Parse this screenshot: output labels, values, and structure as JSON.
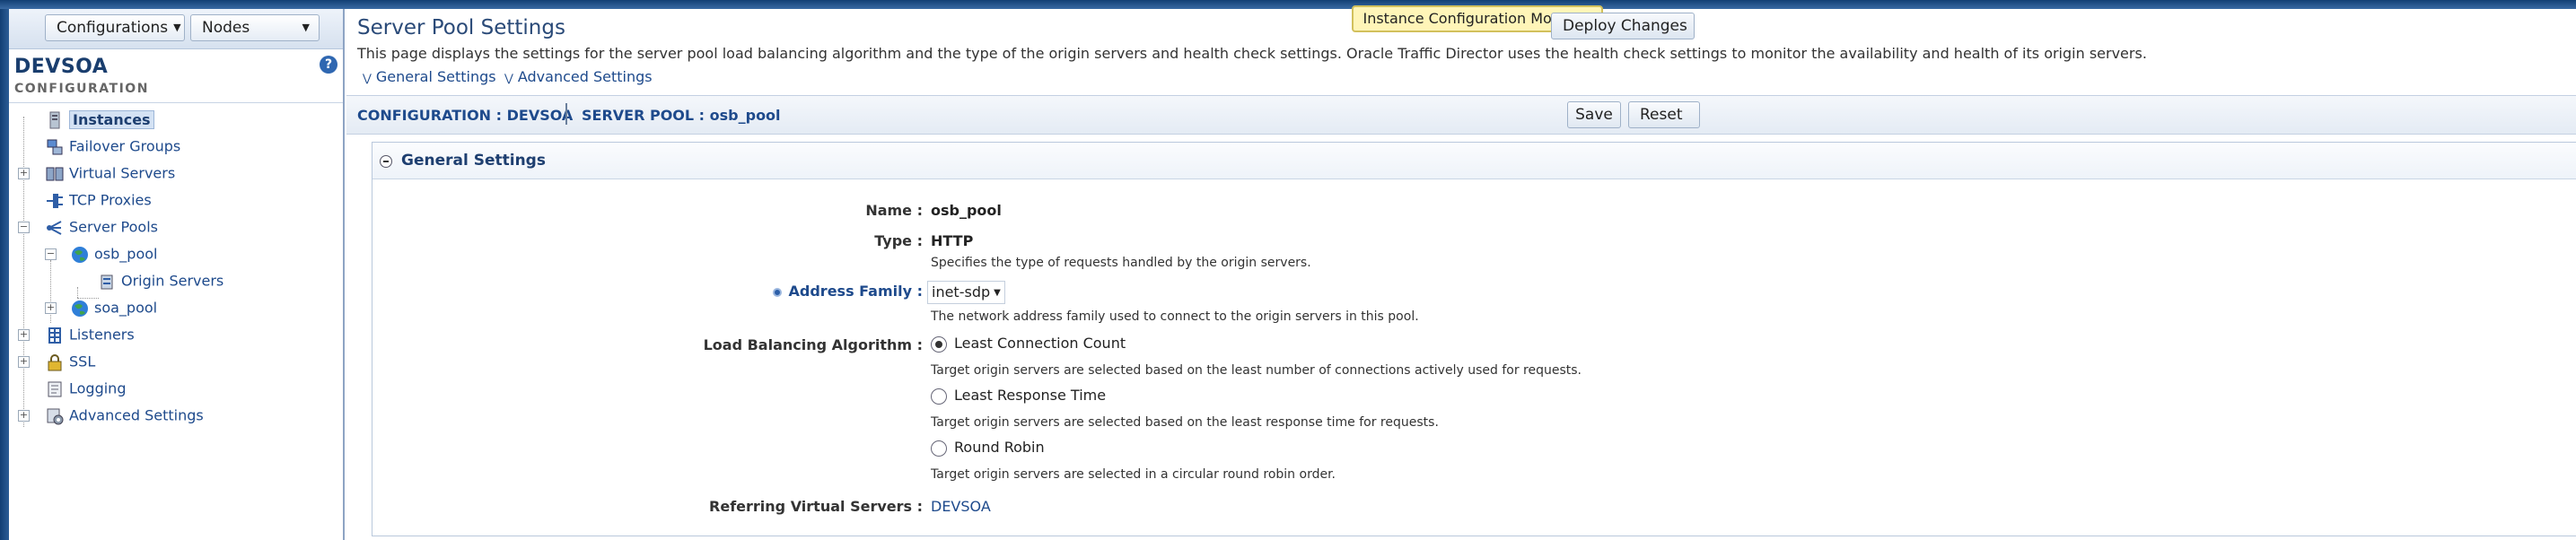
{
  "sidebar": {
    "config_dropdown": "Configurations",
    "nodes_dropdown": "Nodes",
    "title": "DEVSOA",
    "subtitle": "CONFIGURATION",
    "help_icon": "question-icon",
    "tree": [
      {
        "label": "Instances",
        "icon": "instances-icon",
        "selected": true
      },
      {
        "label": "Failover Groups",
        "icon": "failover-icon"
      },
      {
        "label": "Virtual Servers",
        "icon": "virtual-servers-icon"
      },
      {
        "label": "TCP Proxies",
        "icon": "tcp-proxy-icon"
      },
      {
        "label": "Server Pools",
        "icon": "server-pools-icon"
      },
      {
        "label": "osb_pool",
        "icon": "globe-icon"
      },
      {
        "label": "Origin Servers",
        "icon": "origin-servers-icon"
      },
      {
        "label": "soa_pool",
        "icon": "globe-icon"
      },
      {
        "label": "Listeners",
        "icon": "listeners-icon"
      },
      {
        "label": "SSL",
        "icon": "lock-icon"
      },
      {
        "label": "Logging",
        "icon": "logging-icon"
      },
      {
        "label": "Advanced Settings",
        "icon": "advanced-settings-icon"
      }
    ]
  },
  "header": {
    "title": "Server Pool Settings",
    "description": "This page displays the settings for the server pool load balancing algorithm and the type of the origin servers and health check settings. Oracle Traffic Director uses the health check settings to monitor the availability and health of its origin servers.",
    "anchor_general": "General Settings",
    "anchor_advanced": "Advanced Settings",
    "banner": "Instance Configuration Modified",
    "deploy_button": "Deploy Changes"
  },
  "breadcrumb": {
    "config": "CONFIGURATION : DEVSOA",
    "pool": "SERVER POOL : osb_pool",
    "save": "Save",
    "reset": "Reset"
  },
  "general": {
    "section_title": "General Settings",
    "name_label": "Name :",
    "name_value": "osb_pool",
    "type_label": "Type :",
    "type_value": "HTTP",
    "type_hint": "Specifies the type of requests handled by the origin servers.",
    "family_label": "Address Family :",
    "family_value": "inet-sdp",
    "family_hint": "The network address family used to connect to the origin servers in this pool.",
    "lb_label": "Load Balancing Algorithm :",
    "lb_options": [
      {
        "label": "Least Connection Count",
        "hint": "Target origin servers are selected based on the least number of connections actively used for requests.",
        "selected": true
      },
      {
        "label": "Least Response Time",
        "hint": "Target origin servers are selected based on the least response time for requests.",
        "selected": false
      },
      {
        "label": "Round Robin",
        "hint": "Target origin servers are selected in a circular round robin order.",
        "selected": false
      }
    ],
    "vs_label": "Referring Virtual Servers :",
    "vs_value": "DEVSOA"
  }
}
